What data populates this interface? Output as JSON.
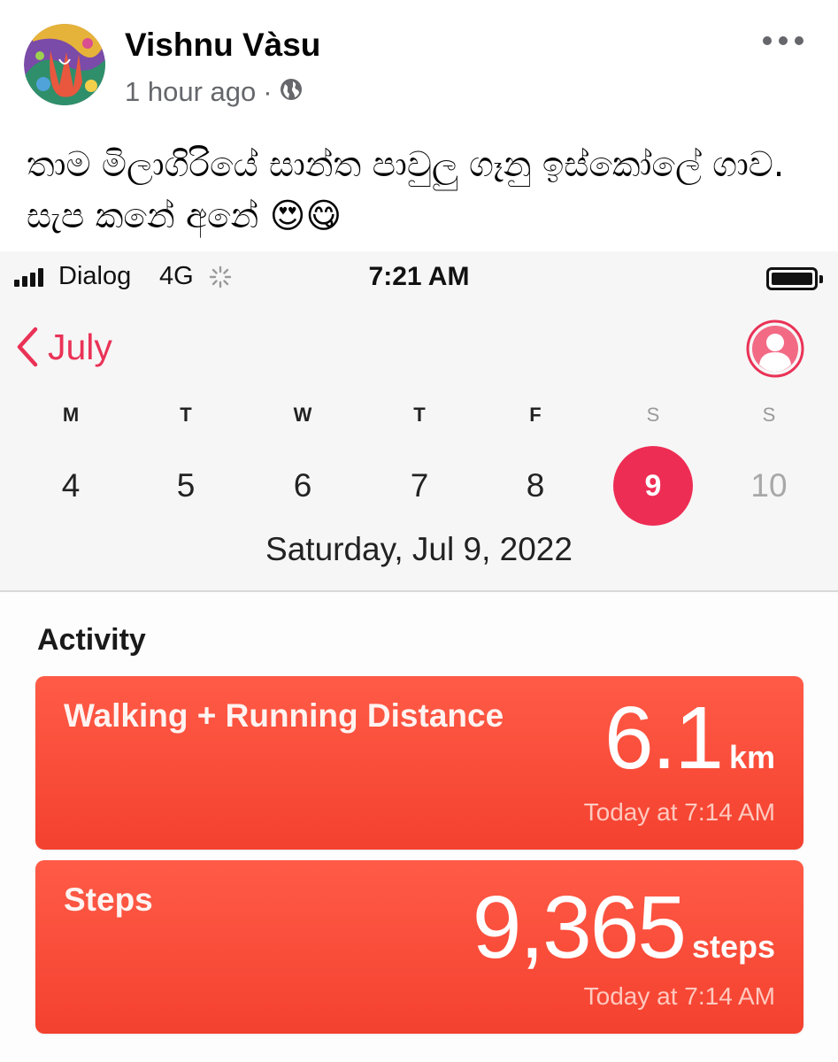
{
  "post": {
    "author": "Vishnu Vàsu",
    "time": "1 hour ago",
    "separator": "·",
    "audience_icon": "globe-icon",
    "more_icon": "more-horizontal-icon",
    "text": "තාම මිලාගිරියේ සාන්ත පාවුලු ගෑනු ඉස්කෝලේ ගාව. සැප කනේ අනේ 😍😋"
  },
  "phone": {
    "status_bar": {
      "carrier": "Dialog",
      "network": "4G",
      "time": "7:21 AM",
      "signal_icon": "signal-bars-icon",
      "activity_icon": "network-activity-spinner-icon",
      "battery_icon": "battery-icon"
    },
    "nav": {
      "back_label": "July",
      "back_icon": "chevron-left-icon",
      "profile_icon": "profile-icon"
    },
    "calendar": {
      "weekdays": [
        "M",
        "T",
        "W",
        "T",
        "F",
        "S",
        "S"
      ],
      "dates": [
        "4",
        "5",
        "6",
        "7",
        "8",
        "9",
        "10"
      ],
      "selected_index": 5,
      "selected_date_label": "Saturday, Jul 9, 2022"
    },
    "activity": {
      "section_title": "Activity",
      "cards": [
        {
          "title": "Walking + Running Distance",
          "value": "6.1",
          "unit": "km",
          "timestamp": "Today at 7:14 AM"
        },
        {
          "title": "Steps",
          "value": "9,365",
          "unit": "steps",
          "timestamp": "Today at 7:14 AM"
        }
      ]
    }
  },
  "colors": {
    "accent": "#ea3257",
    "selected_day": "#ee2d54",
    "card": "#f4412f",
    "fb_secondary_text": "#65676b"
  }
}
